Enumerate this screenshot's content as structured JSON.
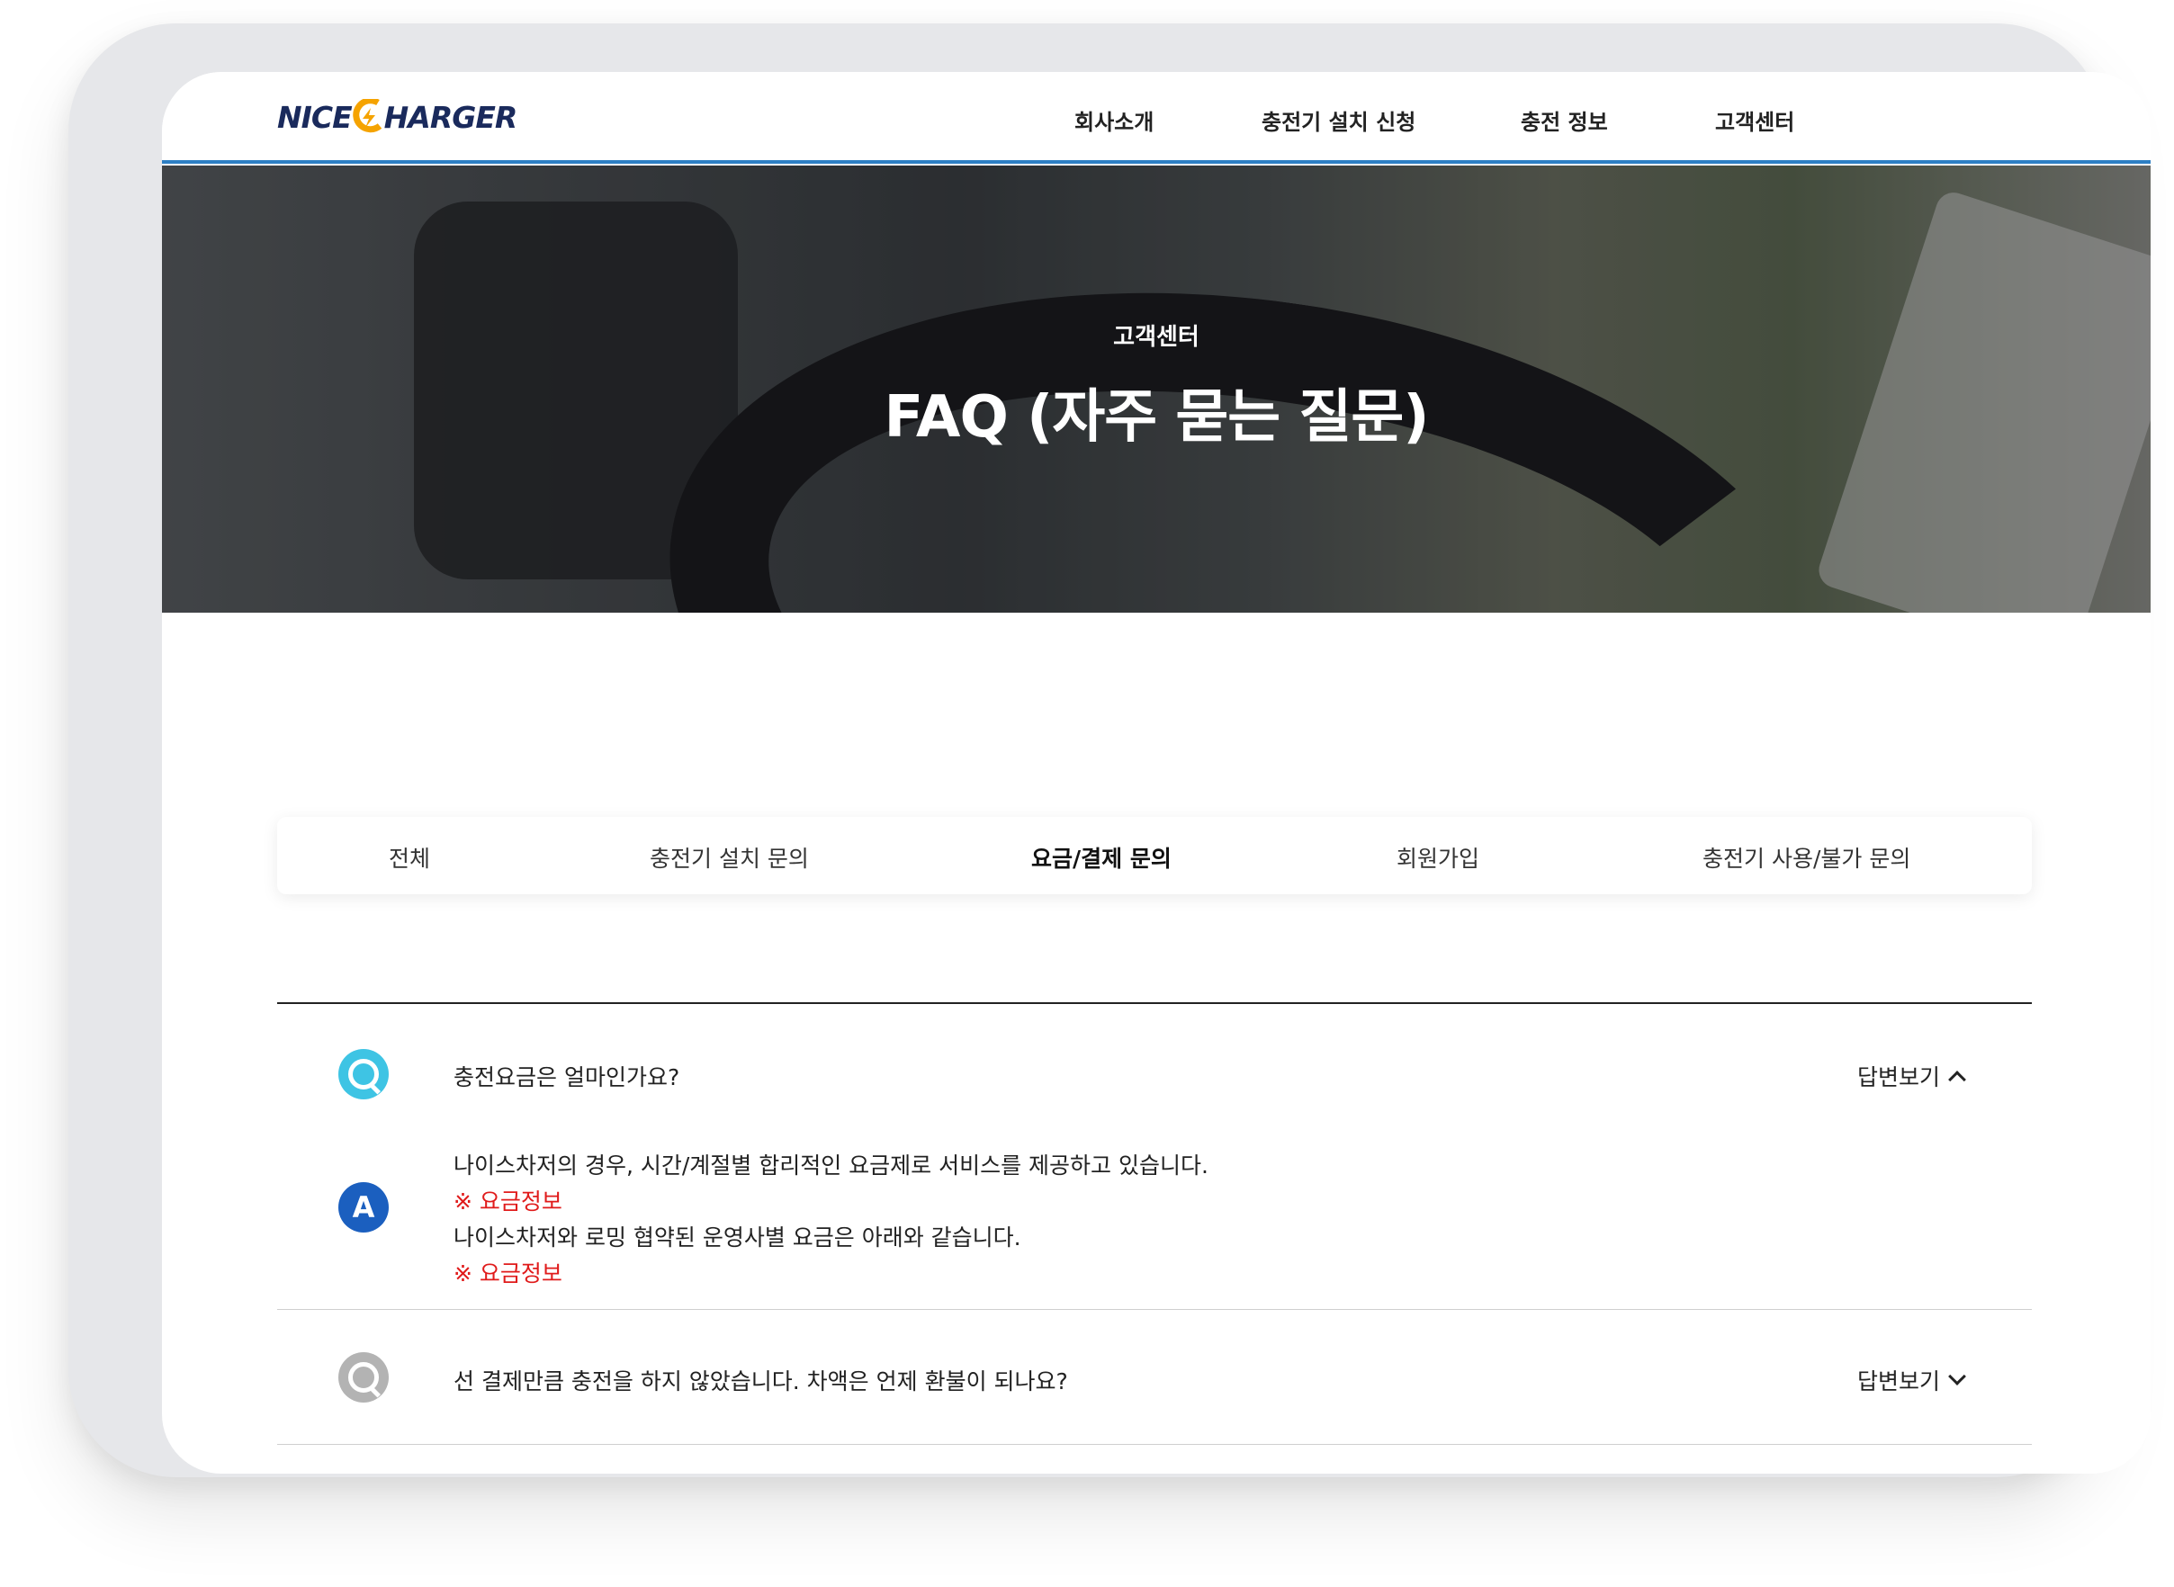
{
  "brand": {
    "logo_left": "NICE",
    "logo_right": "HARGER",
    "logo_accent": "#f5a300",
    "logo_color": "#1a2a5c"
  },
  "nav": {
    "items": [
      "회사소개",
      "충전기 설치 신청",
      "충전 정보",
      "고객센터"
    ]
  },
  "hero": {
    "subtitle": "고객센터",
    "title": "FAQ (자주 묻는 질문)"
  },
  "tabs": {
    "items": [
      "전체",
      "충전기 설치 문의",
      "요금/결제 문의",
      "회원가입",
      "충전기 사용/불가 문의"
    ],
    "active": "요금/결제 문의"
  },
  "faq": {
    "toggle_label": "답변보기",
    "items": [
      {
        "question": "충전요금은 얼마인가요?",
        "open": true,
        "answer_badge": "A",
        "answer_lines": [
          "나이스차저의 경우, 시간/계절별 합리적인 요금제로 서비스를 제공하고 있습니다.",
          "※ 요금정보",
          "나이스차저와 로밍 협약된 운영사별 요금은 아래와 같습니다.",
          "※ 요금정보"
        ]
      },
      {
        "question": "선 결제만큼 충전을 하지 않았습니다. 차액은 언제 환불이 되나요?",
        "open": false
      }
    ]
  },
  "colors": {
    "header_border": "#2d7fc4",
    "q_active": "#3ec4e4",
    "q_inactive": "#b3b3b3",
    "a_badge": "#1b5fbf",
    "note_red": "#e01b1b"
  },
  "icons": [
    "q-badge-icon",
    "a-badge-icon",
    "chevron-up-icon",
    "chevron-down-icon"
  ]
}
